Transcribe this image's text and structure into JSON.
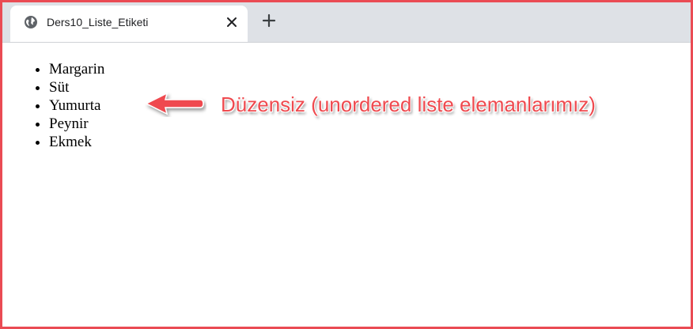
{
  "browser": {
    "tab": {
      "title": "Ders10_Liste_Etiketi",
      "favicon": "globe-icon",
      "close": "close-icon"
    },
    "new_tab": "plus-icon"
  },
  "page": {
    "list_items": [
      "Margarin",
      "Süt",
      "Yumurta",
      "Peynir",
      "Ekmek"
    ]
  },
  "annotation": {
    "text": "Düzensiz (unordered liste elemanlarımız)",
    "color": "#ef4a4f",
    "arrow": "left-arrow-icon"
  },
  "frame_color": "#ea4b54"
}
